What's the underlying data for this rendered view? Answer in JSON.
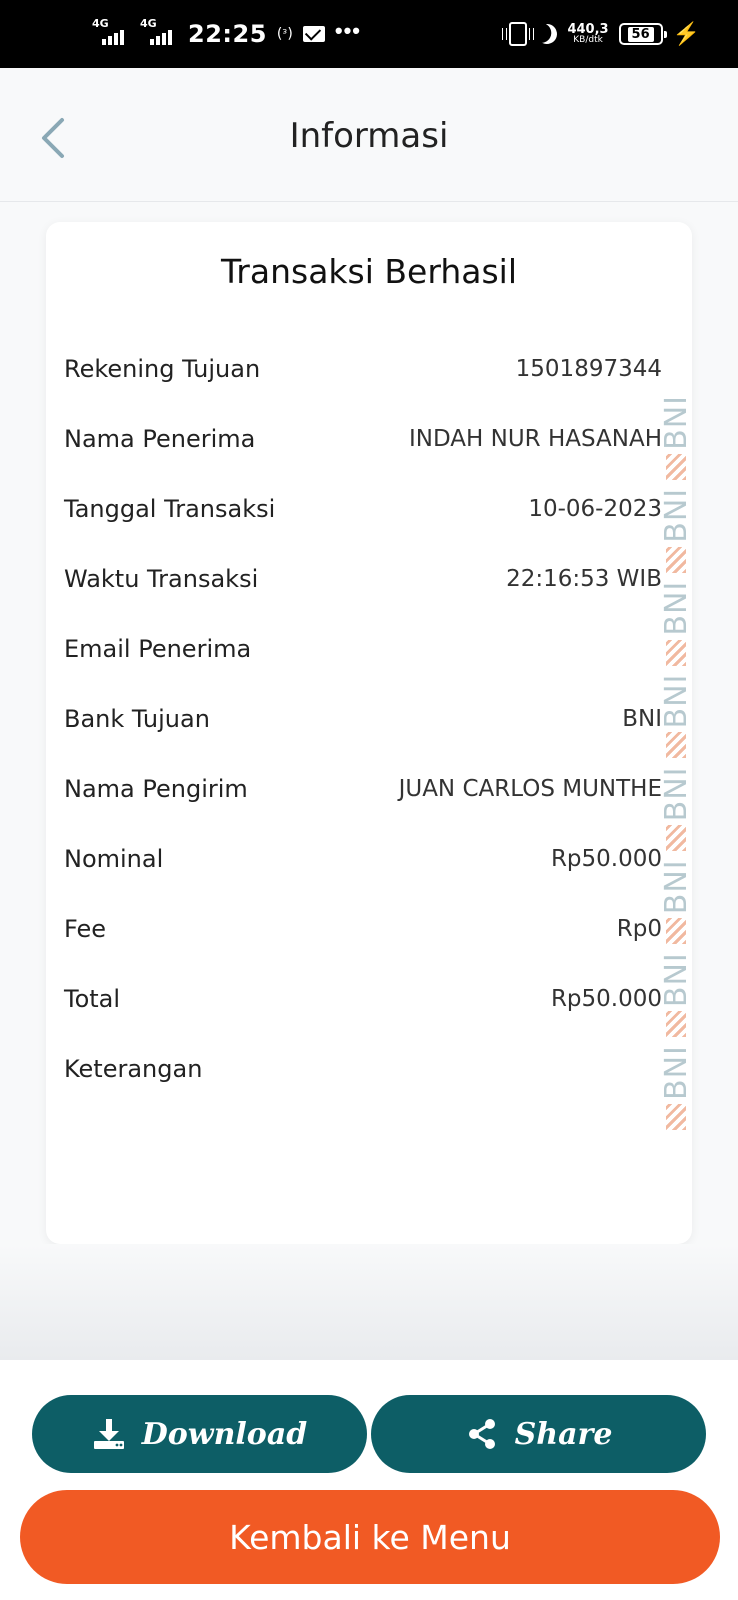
{
  "status_bar": {
    "network_1": "4G",
    "network_2": "4G",
    "time": "22:25",
    "hotspot": "(ᵌ)",
    "dots": "•••",
    "speed_value": "440,3",
    "speed_unit": "KB/dtk",
    "battery": "56"
  },
  "header": {
    "title": "Informasi"
  },
  "card": {
    "title": "Transaksi Berhasil",
    "rows": [
      {
        "label": "Rekening Tujuan",
        "value": "1501897344"
      },
      {
        "label": "Nama Penerima",
        "value": "INDAH NUR HASANAH"
      },
      {
        "label": "Tanggal Transaksi",
        "value": "10-06-2023"
      },
      {
        "label": "Waktu Transaksi",
        "value": "22:16:53 WIB"
      },
      {
        "label": "Email Penerima",
        "value": ""
      },
      {
        "label": "Bank Tujuan",
        "value": "BNI"
      },
      {
        "label": "Nama Pengirim",
        "value": "JUAN CARLOS MUNTHE"
      },
      {
        "label": "Nominal",
        "value": "Rp50.000"
      },
      {
        "label": "Fee",
        "value": "Rp0"
      },
      {
        "label": "Total",
        "value": "Rp50.000"
      },
      {
        "label": "Keterangan",
        "value": ""
      }
    ],
    "watermark_text": "BNI"
  },
  "actions": {
    "download_label": "Download",
    "share_label": "Share",
    "menu_label": "Kembali ke Menu"
  },
  "colors": {
    "primary_teal": "#0d5e66",
    "accent_orange": "#f15a24",
    "back_arrow": "#8aa8b5"
  }
}
